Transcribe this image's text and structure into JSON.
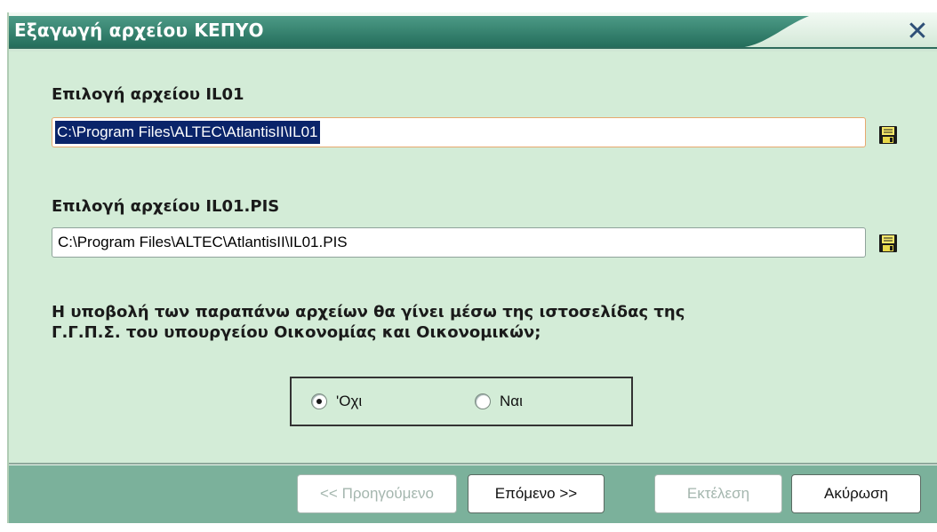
{
  "window": {
    "title": "Εξαγωγή αρχείου ΚΕΠΥΟ",
    "close_label": "✕"
  },
  "file1": {
    "label": "Επιλογή αρχείου IL01",
    "value": "C:\\Program Files\\ALTEC\\AtlantisII\\IL01"
  },
  "file2": {
    "label": "Επιλογή αρχείου IL01.PIS",
    "value": "C:\\Program Files\\ALTEC\\AtlantisII\\IL01.PIS"
  },
  "question": {
    "line1": "Η υποβολή των παραπάνω αρχείων θα γίνει μέσω της ιστοσελίδας της",
    "line2": "Γ.Γ.Π.Σ. του υπουργείου Οικονομίας και Οικονομικών;"
  },
  "radio": {
    "no_label": "'Οχι",
    "yes_label": "Ναι",
    "selected": "no"
  },
  "buttons": {
    "prev": "<< Προηγούμενο",
    "next": "Επόμενο >>",
    "run": "Εκτέλεση",
    "cancel": "Ακύρωση"
  },
  "colors": {
    "titlebar": "#2e7d6a",
    "body": "#d3ecd7",
    "bottom_bar": "#7bb19b",
    "selection": "#0a246a"
  }
}
